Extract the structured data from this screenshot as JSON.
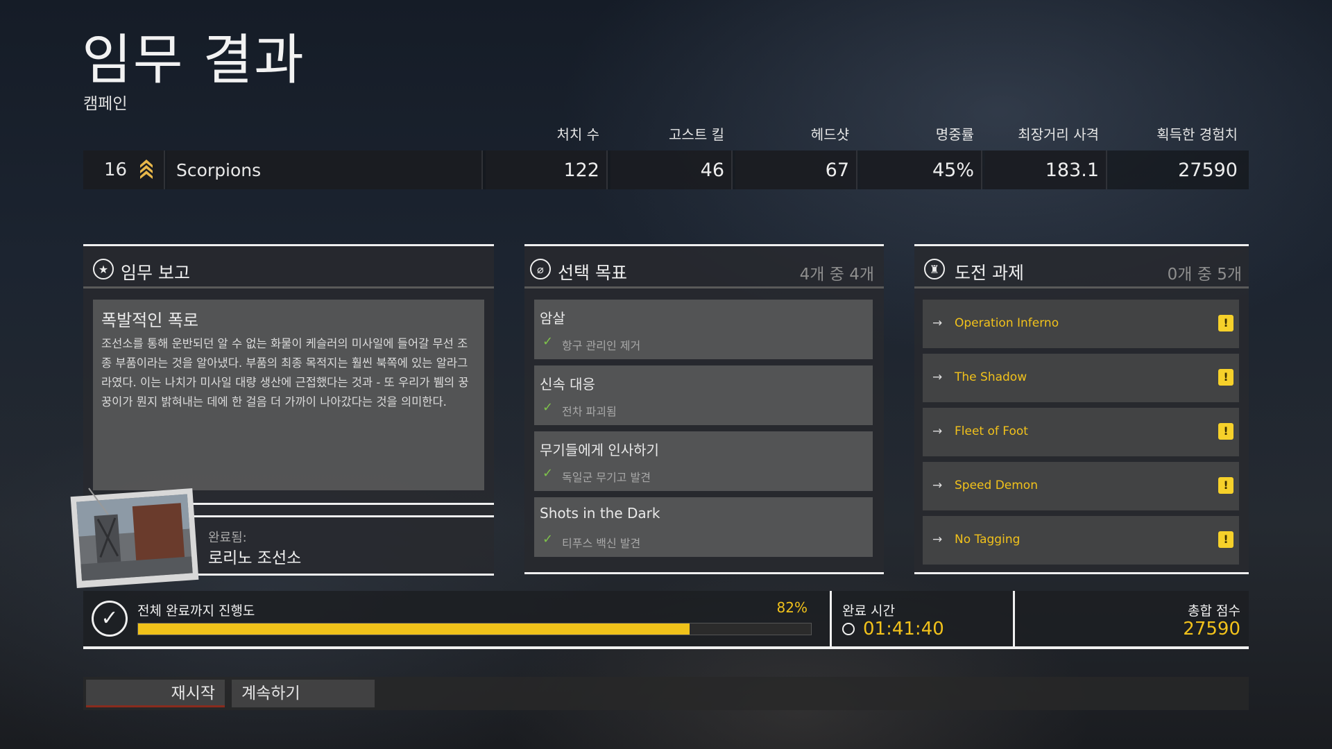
{
  "header": {
    "title": "임무 결과",
    "subtitle": "캠페인"
  },
  "stats": {
    "headers": [
      "처치 수",
      "고스트 킬",
      "헤드샷",
      "명중률",
      "최장거리 사격",
      "획득한 경험치"
    ],
    "rank": "16",
    "rank_icon": "sergeant-chevron-icon",
    "squad_name": "Scorpions",
    "values": [
      "122",
      "46",
      "67",
      "45%",
      "183.1",
      "27590"
    ]
  },
  "mission_report": {
    "title": "임무 보고",
    "icon": "star-circle-icon",
    "heading": "폭발적인 폭로",
    "body": "조선소를 통해 운반되던 알 수 없는 화물이 케슬러의 미사일에 들어갈 무선 조종 부품이라는 것을 알아냈다. 부품의 최종 목적지는 훨씬 북쪽에 있는 알라그라였다. 이는 나치가 미사일 대량 생산에 근접했다는 것과 - 또 우리가 뷈의 꿍꿍이가 뭔지 밝혀내는 데에 한 걸음 더 가까이 나아갔다는 것을 의미한다.",
    "completed_label": "완료됨:",
    "completed_location": "로리노 조선소"
  },
  "objectives": {
    "title": "선택 목표",
    "icon": "compass-circle-icon",
    "count": "4개 중 4개",
    "items": [
      {
        "name": "암살",
        "detail": "항구 관리인 제거"
      },
      {
        "name": "신속 대응",
        "detail": "전차 파괴됨"
      },
      {
        "name": "무기들에게 인사하기",
        "detail": "독일군 무기고 발견"
      },
      {
        "name": "Shots in the Dark",
        "detail": "티푸스 백신 발견"
      }
    ]
  },
  "challenges": {
    "title": "도전 과제",
    "icon": "trophy-circle-icon",
    "count": "0개 중 5개",
    "items": [
      {
        "name": "Operation Inferno"
      },
      {
        "name": "The Shadow"
      },
      {
        "name": "Fleet of Foot"
      },
      {
        "name": "Speed Demon"
      },
      {
        "name": "No Tagging"
      }
    ],
    "accent_color": "#f2c21b"
  },
  "progress": {
    "label": "전체 완료까지 진행도",
    "percent_text": "82%",
    "percent": 82
  },
  "completion_time": {
    "label": "완료 시간",
    "value": "01:41:40"
  },
  "total_score": {
    "label": "총합 점수",
    "value": "27590"
  },
  "buttons": {
    "restart": "재시작",
    "continue": "계속하기"
  }
}
